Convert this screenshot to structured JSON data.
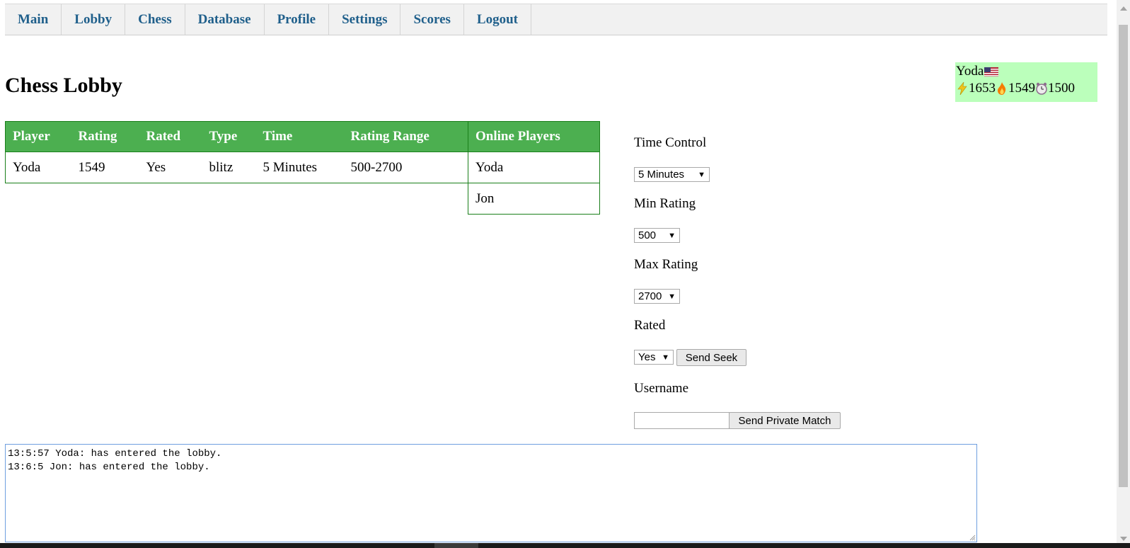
{
  "nav": {
    "items": [
      {
        "label": "Main"
      },
      {
        "label": "Lobby"
      },
      {
        "label": "Chess"
      },
      {
        "label": "Database"
      },
      {
        "label": "Profile"
      },
      {
        "label": "Settings"
      },
      {
        "label": "Scores"
      },
      {
        "label": "Logout"
      }
    ]
  },
  "page": {
    "title": "Chess Lobby"
  },
  "user": {
    "name": "Yoda",
    "flag_icon": "us-flag-icon",
    "ratings": [
      {
        "icon": "lightning-icon",
        "value": "1653"
      },
      {
        "icon": "fire-icon",
        "value": "1549"
      },
      {
        "icon": "clock-icon",
        "value": "1500"
      }
    ],
    "card_color": "#bbffbb"
  },
  "seeks": {
    "headers": [
      "Player",
      "Rating",
      "Rated",
      "Type",
      "Time",
      "Rating Range"
    ],
    "rows": [
      [
        "Yoda",
        "1549",
        "Yes",
        "blitz",
        "5 Minutes",
        "500-2700"
      ]
    ],
    "header_color": "#4caf50"
  },
  "online": {
    "header": "Online Players",
    "players": [
      "Yoda",
      "Jon"
    ]
  },
  "form": {
    "time_control_label": "Time Control",
    "time_control_value": "5 Minutes",
    "min_rating_label": "Min Rating",
    "min_rating_value": "500",
    "max_rating_label": "Max Rating",
    "max_rating_value": "2700",
    "rated_label": "Rated",
    "rated_value": "Yes",
    "send_seek": "Send Seek",
    "username_label": "Username",
    "username_value": "",
    "send_private": "Send Private Match"
  },
  "chat": {
    "lines": [
      "13:5:57 Yoda: has entered the lobby.",
      "13:6:5 Jon: has entered the lobby."
    ]
  }
}
